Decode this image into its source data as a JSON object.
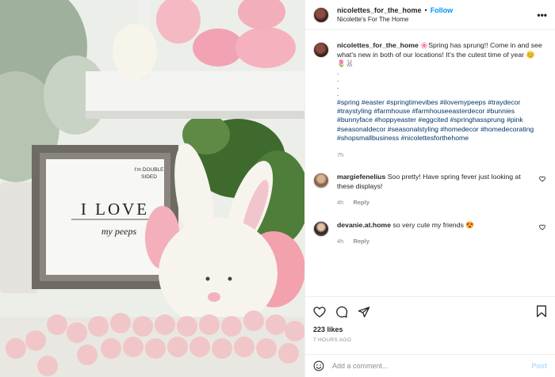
{
  "photo": {
    "sign_small": "I'm DOUBLE SIDED",
    "sign_big": "I LOVE",
    "sign_sub": "my peeps"
  },
  "header": {
    "username": "nicolettes_for_the_home",
    "separator": "•",
    "follow_label": "Follow",
    "location": "Nicolette's For The Home",
    "more_label": "•••"
  },
  "caption": {
    "username": "nicolettes_for_the_home",
    "text": "Spring has sprung!! Come in and see what's new in both of our locations! It's the cutest time of year 😊",
    "emoji_line": "🌷🐰",
    "dots": [
      ".",
      ".",
      ".",
      "."
    ],
    "hashtags": "#spring #easter #springtimevibes #ilovemypeeps #traydecor #traystyling #farmhouse #farmhouseeasterdecor #bunnies #bunnyface #hoppyeaster #eggcited #springhassprung #pink #seasonaldecor #seasonalstyling #homedecor #homedecorating #shopsmallbusiness #nicolettesforthehome",
    "age": "7h",
    "flower_emoji": "🌸"
  },
  "comments": [
    {
      "username": "margiefenelius",
      "text": "Soo pretty! Have spring fever just looking at these displays!",
      "age": "4h",
      "reply_label": "Reply"
    },
    {
      "username": "devanie.at.home",
      "text": "so very cute my friends 😍",
      "age": "4h",
      "reply_label": "Reply"
    }
  ],
  "likes": "223 likes",
  "timestamp": "7 HOURS AGO",
  "add_comment": {
    "placeholder": "Add a comment...",
    "post_label": "Post"
  },
  "colors": {
    "link": "#0095f6",
    "hashtag": "#00376b",
    "muted": "#8e8e8e",
    "post_disabled": "#b3dbff"
  }
}
